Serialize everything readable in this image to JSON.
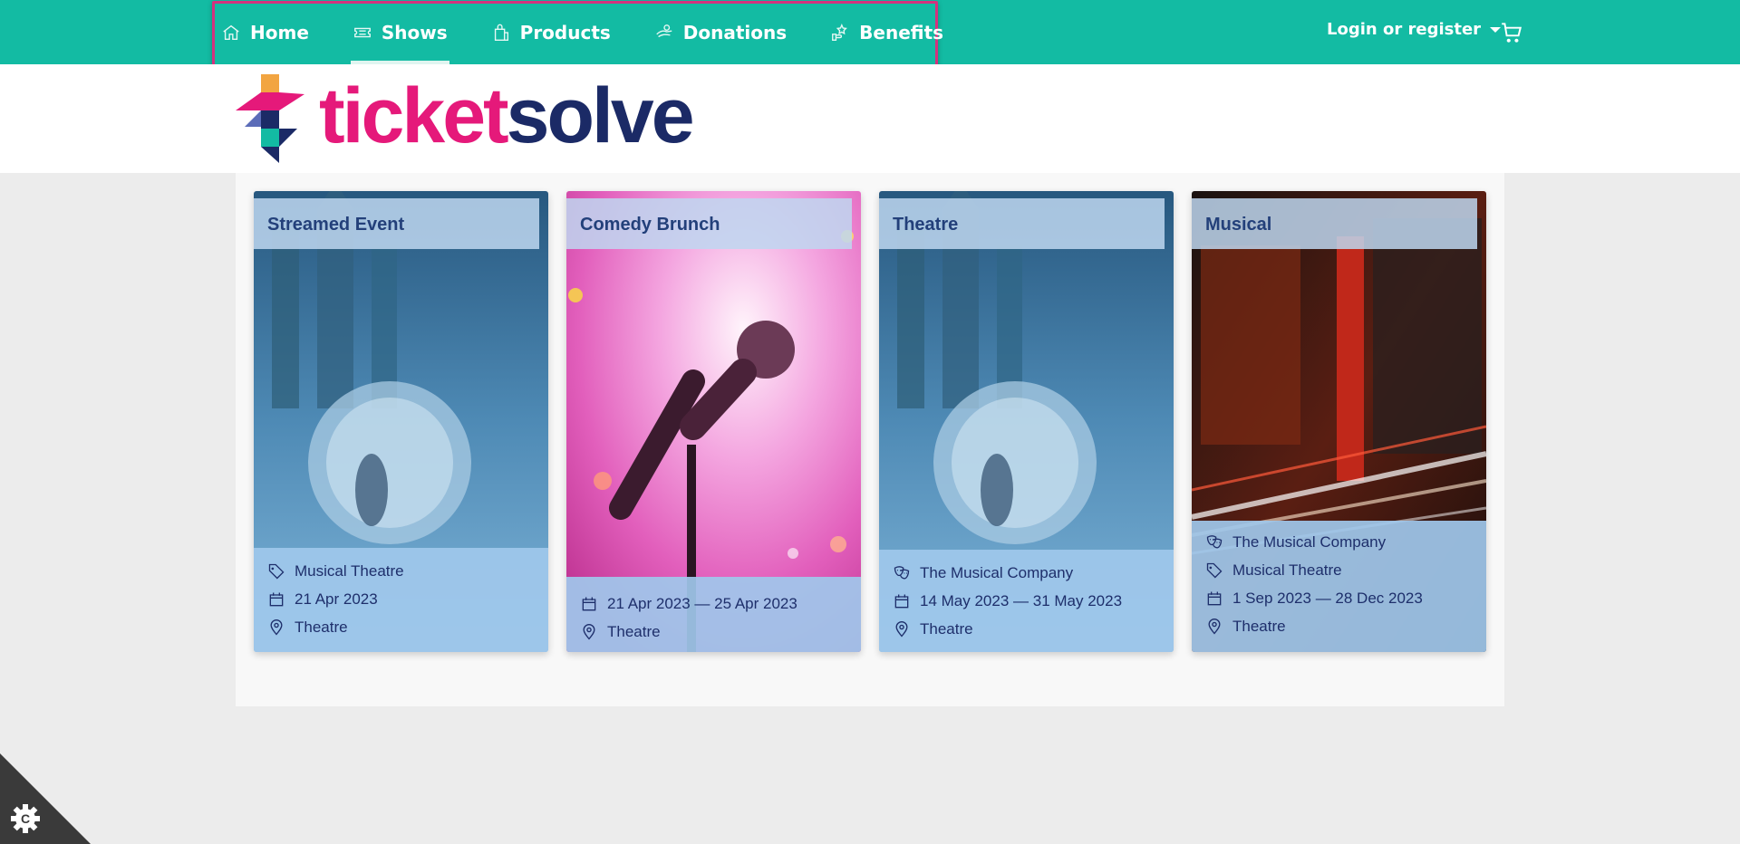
{
  "nav": {
    "items": [
      {
        "label": "Home",
        "icon": "home-icon"
      },
      {
        "label": "Shows",
        "icon": "ticket-icon"
      },
      {
        "label": "Products",
        "icon": "shopping-bag-icon"
      },
      {
        "label": "Donations",
        "icon": "donate-hand-icon"
      },
      {
        "label": "Benefits",
        "icon": "star-hand-icon"
      }
    ],
    "active": "Shows"
  },
  "account": {
    "login_label": "Login or register"
  },
  "logo": {
    "part1": "ticket",
    "part2": "solve"
  },
  "cards": [
    {
      "title": "Streamed Event",
      "company": "",
      "category": "Musical Theatre",
      "date": "21 Apr 2023",
      "venue": "Theatre"
    },
    {
      "title": "Comedy Brunch",
      "company": "",
      "category": "",
      "date": "21 Apr 2023 — 25 Apr 2023",
      "venue": "Theatre"
    },
    {
      "title": "Theatre",
      "company": "The Musical Company",
      "category": "",
      "date": "14 May 2023 — 31 May 2023",
      "venue": "Theatre"
    },
    {
      "title": "Musical",
      "company": "The Musical Company",
      "category": "Musical Theatre",
      "date": "1 Sep 2023 — 28 Dec 2023",
      "venue": "Theatre"
    }
  ],
  "colors": {
    "brand_teal": "#13bba3",
    "brand_pink": "#e5197a",
    "brand_navy": "#1b2a66",
    "highlight": "#d4327e"
  }
}
